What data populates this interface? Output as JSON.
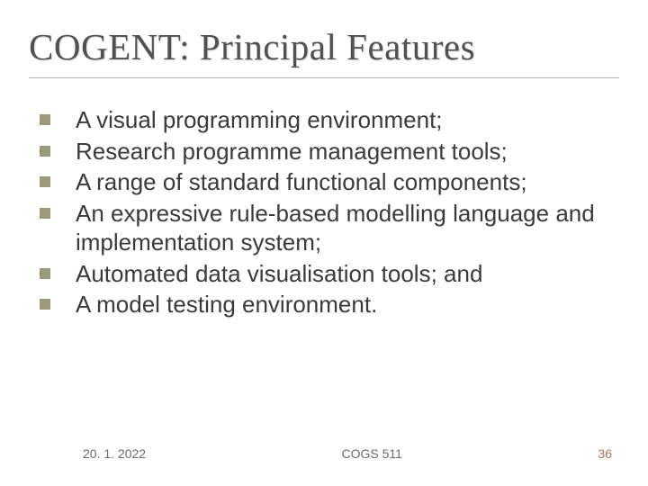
{
  "title": "COGENT: Principal Features",
  "bullets": [
    "A visual programming environment;",
    "Research programme management tools;",
    "A range of standard functional components;",
    "An expressive rule-based modelling language and implementation system;",
    "Automated data visualisation tools; and",
    "A model testing environment."
  ],
  "footer": {
    "date": "20. 1. 2022",
    "center": "COGS 511",
    "page": "36"
  }
}
